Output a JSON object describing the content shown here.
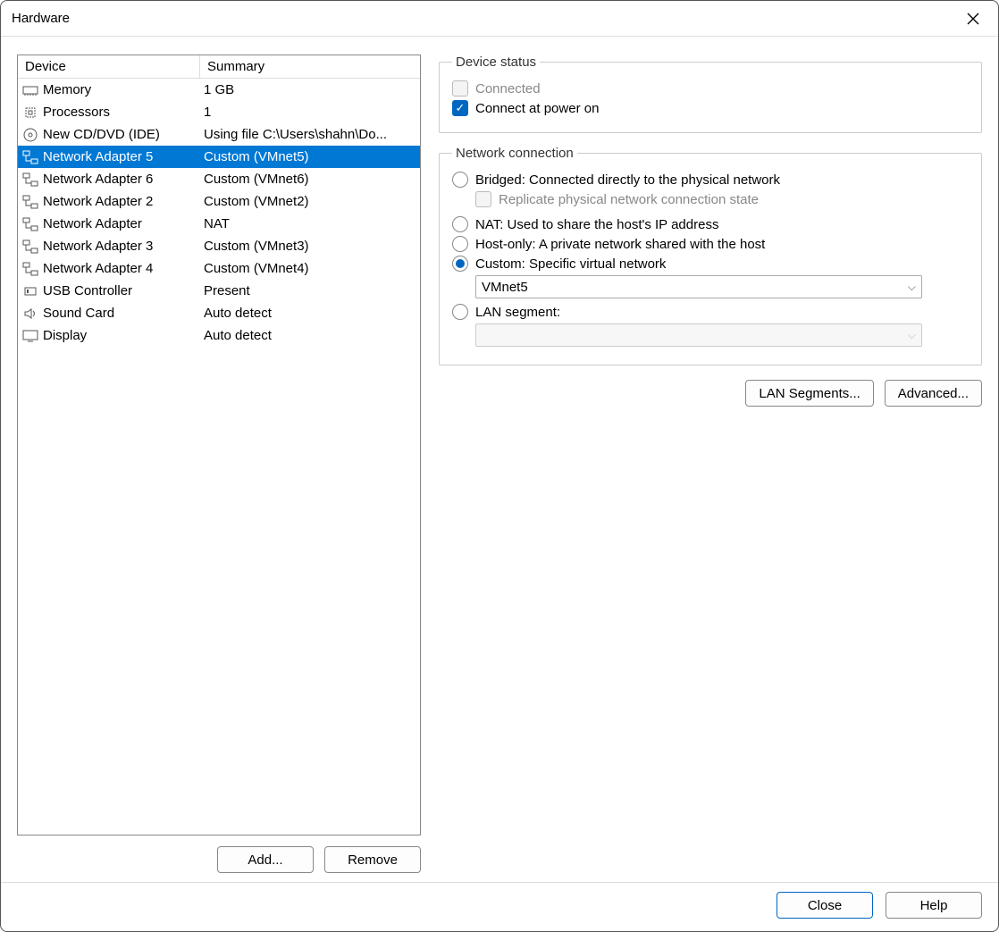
{
  "window": {
    "title": "Hardware"
  },
  "table": {
    "headers": {
      "device": "Device",
      "summary": "Summary"
    },
    "rows": [
      {
        "icon": "memory",
        "name": "Memory",
        "summary": "1 GB",
        "selected": false
      },
      {
        "icon": "cpu",
        "name": "Processors",
        "summary": "1",
        "selected": false
      },
      {
        "icon": "disc",
        "name": "New CD/DVD (IDE)",
        "summary": "Using file C:\\Users\\shahn\\Do...",
        "selected": false
      },
      {
        "icon": "net",
        "name": "Network Adapter 5",
        "summary": "Custom (VMnet5)",
        "selected": true
      },
      {
        "icon": "net",
        "name": "Network Adapter 6",
        "summary": "Custom (VMnet6)",
        "selected": false
      },
      {
        "icon": "net",
        "name": "Network Adapter 2",
        "summary": "Custom (VMnet2)",
        "selected": false
      },
      {
        "icon": "net",
        "name": "Network Adapter",
        "summary": "NAT",
        "selected": false
      },
      {
        "icon": "net",
        "name": "Network Adapter 3",
        "summary": "Custom (VMnet3)",
        "selected": false
      },
      {
        "icon": "net",
        "name": "Network Adapter 4",
        "summary": "Custom (VMnet4)",
        "selected": false
      },
      {
        "icon": "usb",
        "name": "USB Controller",
        "summary": "Present",
        "selected": false
      },
      {
        "icon": "sound",
        "name": "Sound Card",
        "summary": "Auto detect",
        "selected": false
      },
      {
        "icon": "display",
        "name": "Display",
        "summary": "Auto detect",
        "selected": false
      }
    ]
  },
  "leftButtons": {
    "add": "Add...",
    "remove": "Remove"
  },
  "deviceStatus": {
    "legend": "Device status",
    "connected": {
      "label": "Connected",
      "checked": false,
      "disabled": true
    },
    "connectAtPowerOn": {
      "label": "Connect at power on",
      "checked": true
    }
  },
  "networkConnection": {
    "legend": "Network connection",
    "bridged": {
      "label": "Bridged: Connected directly to the physical network",
      "checked": false
    },
    "replicate": {
      "label": "Replicate physical network connection state",
      "checked": false,
      "disabled": true
    },
    "nat": {
      "label": "NAT: Used to share the host's IP address",
      "checked": false
    },
    "hostOnly": {
      "label": "Host-only: A private network shared with the host",
      "checked": false
    },
    "custom": {
      "label": "Custom: Specific virtual network",
      "checked": true
    },
    "customSelect": {
      "value": "VMnet5"
    },
    "lanSegment": {
      "label": "LAN segment:",
      "checked": false
    },
    "lanSelect": {
      "value": "",
      "disabled": true
    }
  },
  "rightButtons": {
    "lanSegments": "LAN Segments...",
    "advanced": "Advanced..."
  },
  "footer": {
    "close": "Close",
    "help": "Help"
  }
}
